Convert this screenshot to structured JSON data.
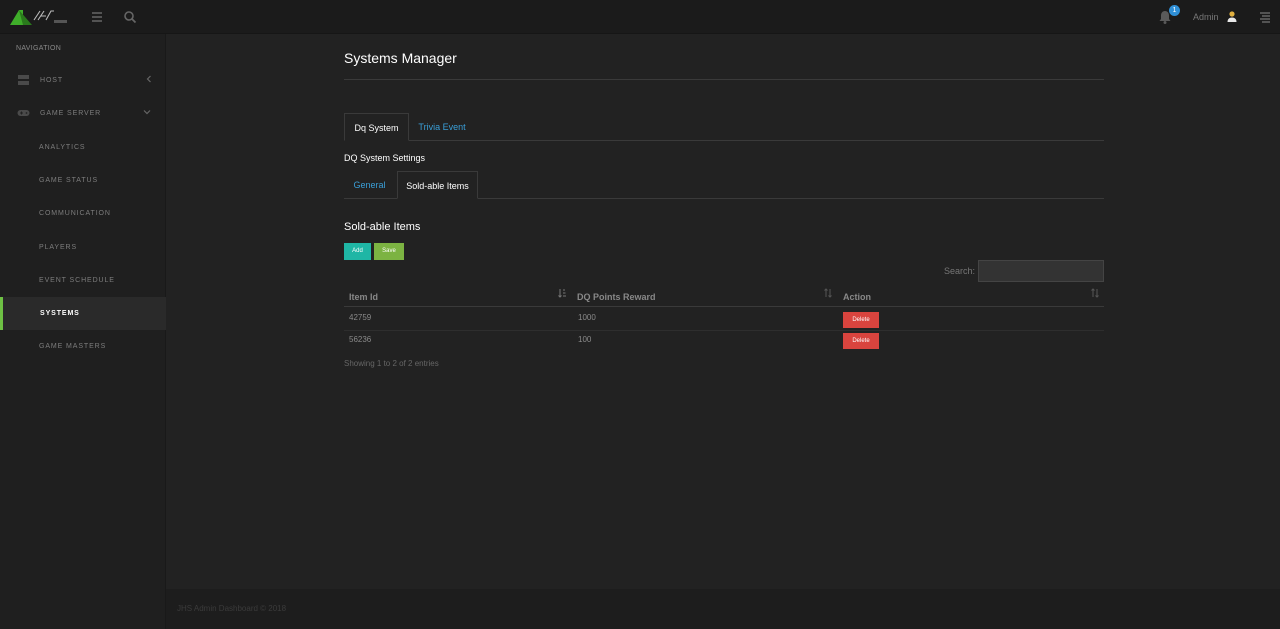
{
  "topbar": {
    "notification_count": "1",
    "admin_label": "Admin"
  },
  "sidebar": {
    "header": "NAVIGATION",
    "items": [
      {
        "label": "HOST"
      },
      {
        "label": "GAME SERVER"
      },
      {
        "label": "ANALYTICS"
      },
      {
        "label": "GAME STATUS"
      },
      {
        "label": "COMMUNICATION"
      },
      {
        "label": "PLAYERS"
      },
      {
        "label": "EVENT SCHEDULE"
      },
      {
        "label": "SYSTEMS"
      },
      {
        "label": "GAME MASTERS"
      }
    ]
  },
  "main": {
    "title": "Systems Manager",
    "tabs": [
      {
        "label": "Dq System"
      },
      {
        "label": "Trivia Event"
      }
    ],
    "settings_label": "DQ System Settings",
    "subtabs": [
      {
        "label": "General"
      },
      {
        "label": "Sold-able Items"
      }
    ],
    "section_title": "Sold-able Items",
    "add_label": "Add",
    "save_label": "Save",
    "search_label": "Search:",
    "search_value": "",
    "columns": [
      "Item Id",
      "DQ Points Reward",
      "Action"
    ],
    "rows": [
      {
        "item_id": "42759",
        "reward": "1000",
        "action": "Delete"
      },
      {
        "item_id": "56236",
        "reward": "100",
        "action": "Delete"
      }
    ],
    "info": "Showing 1 to 2 of 2 entries"
  },
  "footer": {
    "text": "JHS Admin Dashboard © 2018"
  },
  "colors": {
    "accent_green": "#6ec144",
    "link_blue": "#3a9fd8",
    "delete_red": "#d9443e",
    "add_teal": "#1fb6a5",
    "save_green": "#7cb342"
  }
}
